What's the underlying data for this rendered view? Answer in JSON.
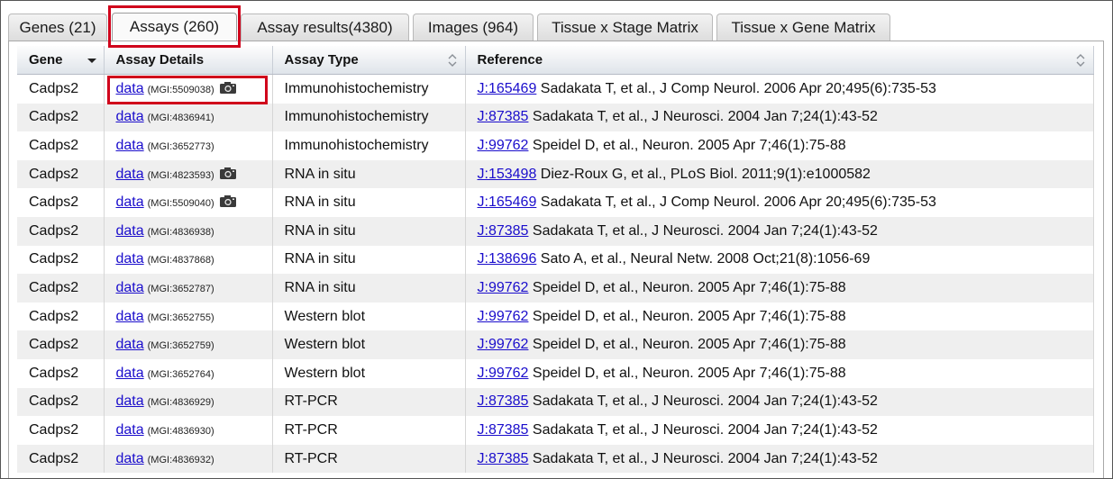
{
  "tabs": [
    {
      "label": "Genes (21)",
      "active": false
    },
    {
      "label": "Assays (260)",
      "active": true
    },
    {
      "label": "Assay results(4380)",
      "active": false
    },
    {
      "label": "Images (964)",
      "active": false
    },
    {
      "label": "Tissue x Stage Matrix",
      "active": false
    },
    {
      "label": "Tissue x Gene Matrix",
      "active": false
    }
  ],
  "table": {
    "columns": [
      "Gene",
      "Assay Details",
      "Assay Type",
      "Reference"
    ],
    "rows": [
      {
        "gene": "Cadps2",
        "link": "data",
        "mgi": "(MGI:5509038)",
        "image": true,
        "type": "Immunohistochemistry",
        "ref_id": "J:165469",
        "citation": "Sadakata T, et al., J Comp Neurol. 2006 Apr 20;495(6):735-53"
      },
      {
        "gene": "Cadps2",
        "link": "data",
        "mgi": "(MGI:4836941)",
        "image": false,
        "type": "Immunohistochemistry",
        "ref_id": "J:87385",
        "citation": "Sadakata T, et al., J Neurosci. 2004 Jan 7;24(1):43-52"
      },
      {
        "gene": "Cadps2",
        "link": "data",
        "mgi": "(MGI:3652773)",
        "image": false,
        "type": "Immunohistochemistry",
        "ref_id": "J:99762",
        "citation": "Speidel D, et al., Neuron. 2005 Apr 7;46(1):75-88"
      },
      {
        "gene": "Cadps2",
        "link": "data",
        "mgi": "(MGI:4823593)",
        "image": true,
        "type": "RNA in situ",
        "ref_id": "J:153498",
        "citation": "Diez-Roux G, et al., PLoS Biol. 2011;9(1):e1000582"
      },
      {
        "gene": "Cadps2",
        "link": "data",
        "mgi": "(MGI:5509040)",
        "image": true,
        "type": "RNA in situ",
        "ref_id": "J:165469",
        "citation": "Sadakata T, et al., J Comp Neurol. 2006 Apr 20;495(6):735-53"
      },
      {
        "gene": "Cadps2",
        "link": "data",
        "mgi": "(MGI:4836938)",
        "image": false,
        "type": "RNA in situ",
        "ref_id": "J:87385",
        "citation": "Sadakata T, et al., J Neurosci. 2004 Jan 7;24(1):43-52"
      },
      {
        "gene": "Cadps2",
        "link": "data",
        "mgi": "(MGI:4837868)",
        "image": false,
        "type": "RNA in situ",
        "ref_id": "J:138696",
        "citation": "Sato A, et al., Neural Netw. 2008 Oct;21(8):1056-69"
      },
      {
        "gene": "Cadps2",
        "link": "data",
        "mgi": "(MGI:3652787)",
        "image": false,
        "type": "RNA in situ",
        "ref_id": "J:99762",
        "citation": "Speidel D, et al., Neuron. 2005 Apr 7;46(1):75-88"
      },
      {
        "gene": "Cadps2",
        "link": "data",
        "mgi": "(MGI:3652755)",
        "image": false,
        "type": "Western blot",
        "ref_id": "J:99762",
        "citation": "Speidel D, et al., Neuron. 2005 Apr 7;46(1):75-88"
      },
      {
        "gene": "Cadps2",
        "link": "data",
        "mgi": "(MGI:3652759)",
        "image": false,
        "type": "Western blot",
        "ref_id": "J:99762",
        "citation": "Speidel D, et al., Neuron. 2005 Apr 7;46(1):75-88"
      },
      {
        "gene": "Cadps2",
        "link": "data",
        "mgi": "(MGI:3652764)",
        "image": false,
        "type": "Western blot",
        "ref_id": "J:99762",
        "citation": "Speidel D, et al., Neuron. 2005 Apr 7;46(1):75-88"
      },
      {
        "gene": "Cadps2",
        "link": "data",
        "mgi": "(MGI:4836929)",
        "image": false,
        "type": "RT-PCR",
        "ref_id": "J:87385",
        "citation": "Sadakata T, et al., J Neurosci. 2004 Jan 7;24(1):43-52"
      },
      {
        "gene": "Cadps2",
        "link": "data",
        "mgi": "(MGI:4836930)",
        "image": false,
        "type": "RT-PCR",
        "ref_id": "J:87385",
        "citation": "Sadakata T, et al., J Neurosci. 2004 Jan 7;24(1):43-52"
      },
      {
        "gene": "Cadps2",
        "link": "data",
        "mgi": "(MGI:4836932)",
        "image": false,
        "type": "RT-PCR",
        "ref_id": "J:87385",
        "citation": "Sadakata T, et al., J Neurosci. 2004 Jan 7;24(1):43-52"
      }
    ]
  },
  "highlight_color": "#d0021b",
  "link_color": "#1a0dcc",
  "icons": {
    "image_indicator": "camera-icon",
    "gene_sort": "sort-descending-icon",
    "column_sort": "sort-both-icon"
  }
}
